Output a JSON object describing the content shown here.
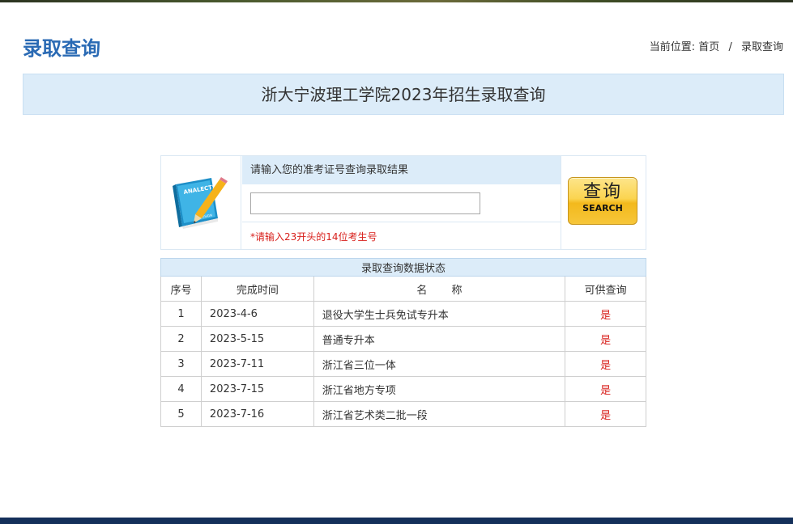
{
  "header": {
    "page_title": "录取查询",
    "breadcrumb_prefix": "当前位置:",
    "breadcrumb_home": "首页",
    "breadcrumb_separator": "/",
    "breadcrumb_current": "录取查询"
  },
  "banner": {
    "title": "浙大宁波理工学院2023年招生录取查询"
  },
  "search": {
    "prompt": "请输入您的准考证号查询录取结果",
    "input_value": "",
    "hint": "*请输入23开头的14位考生号",
    "button_label_cn": "查询",
    "button_label_en": "SEARCH",
    "book_text_top": "ANALECTS",
    "book_text_bottom": "DESIGN"
  },
  "status_table": {
    "caption": "录取查询数据状态",
    "headers": {
      "index": "序号",
      "date": "完成时间",
      "name_a": "名",
      "name_b": "称",
      "available": "可供查询"
    },
    "rows": [
      {
        "index": "1",
        "date": "2023-4-6",
        "name": "退役大学生士兵免试专升本",
        "available": "是"
      },
      {
        "index": "2",
        "date": "2023-5-15",
        "name": "普通专升本",
        "available": "是"
      },
      {
        "index": "3",
        "date": "2023-7-11",
        "name": "浙江省三位一体",
        "available": "是"
      },
      {
        "index": "4",
        "date": "2023-7-15",
        "name": "浙江省地方专项",
        "available": "是"
      },
      {
        "index": "5",
        "date": "2023-7-16",
        "name": "浙江省艺术类二批一段",
        "available": "是"
      }
    ]
  },
  "colors": {
    "title_blue": "#2a6ab4",
    "banner_bg": "#dcecf9",
    "hint_red": "#d8201c",
    "button_gold": "#fbd450",
    "footer_navy": "#14305a"
  }
}
